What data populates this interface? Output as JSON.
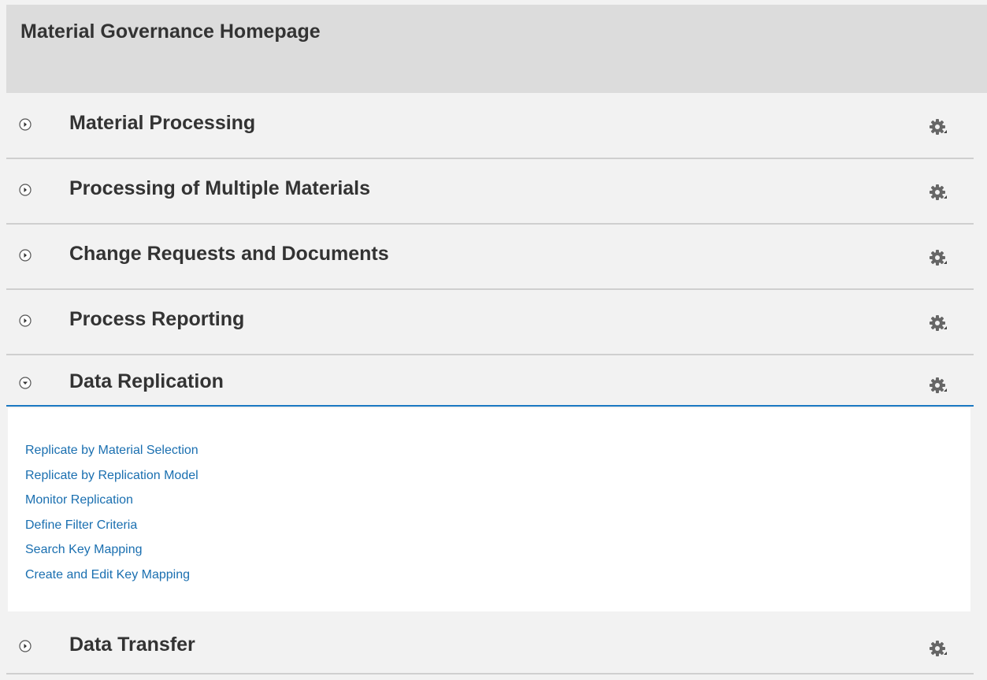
{
  "header": {
    "title": "Material Governance Homepage"
  },
  "sections": [
    {
      "title": "Material Processing",
      "expanded": false
    },
    {
      "title": "Processing of Multiple Materials",
      "expanded": false
    },
    {
      "title": "Change Requests and Documents",
      "expanded": false
    },
    {
      "title": "Process Reporting",
      "expanded": false
    },
    {
      "title": "Data Replication",
      "expanded": true,
      "links": [
        "Replicate by Material Selection",
        "Replicate by Replication Model",
        "Monitor Replication",
        "Define Filter Criteria",
        "Search Key Mapping",
        "Create and Edit Key Mapping"
      ]
    },
    {
      "title": "Data Transfer",
      "expanded": false
    }
  ],
  "icons": {
    "toggle_collapsed": "chevron-right-circle-icon",
    "toggle_expanded": "chevron-down-circle-icon",
    "settings": "gear-icon"
  },
  "colors": {
    "link": "#1a6fb0",
    "active_underline": "#1a78c2",
    "header_bg": "#dcdcdc",
    "page_bg": "#f2f2f2"
  }
}
